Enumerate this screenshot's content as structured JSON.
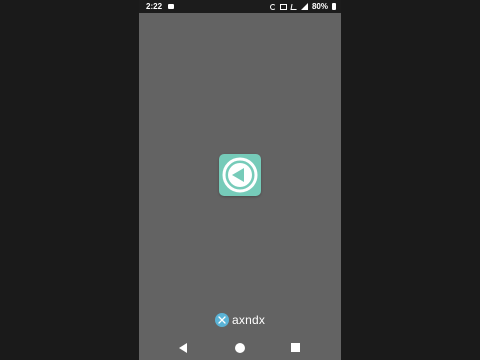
{
  "status_bar": {
    "time": "2:22",
    "battery": "80%",
    "icons": [
      "notification-icon",
      "sync-icon",
      "vibrate-icon",
      "no-sim-icon",
      "signal-icon",
      "battery-icon"
    ]
  },
  "splash": {
    "app_icon": "play-back-circle-icon",
    "icon_color": "#76cbb9",
    "background_color": "#636363"
  },
  "brand": {
    "name": "axndx",
    "mark_color": "#5ab3d6"
  },
  "nav_bar": {
    "buttons": [
      "back-button",
      "home-button",
      "recents-button"
    ]
  }
}
